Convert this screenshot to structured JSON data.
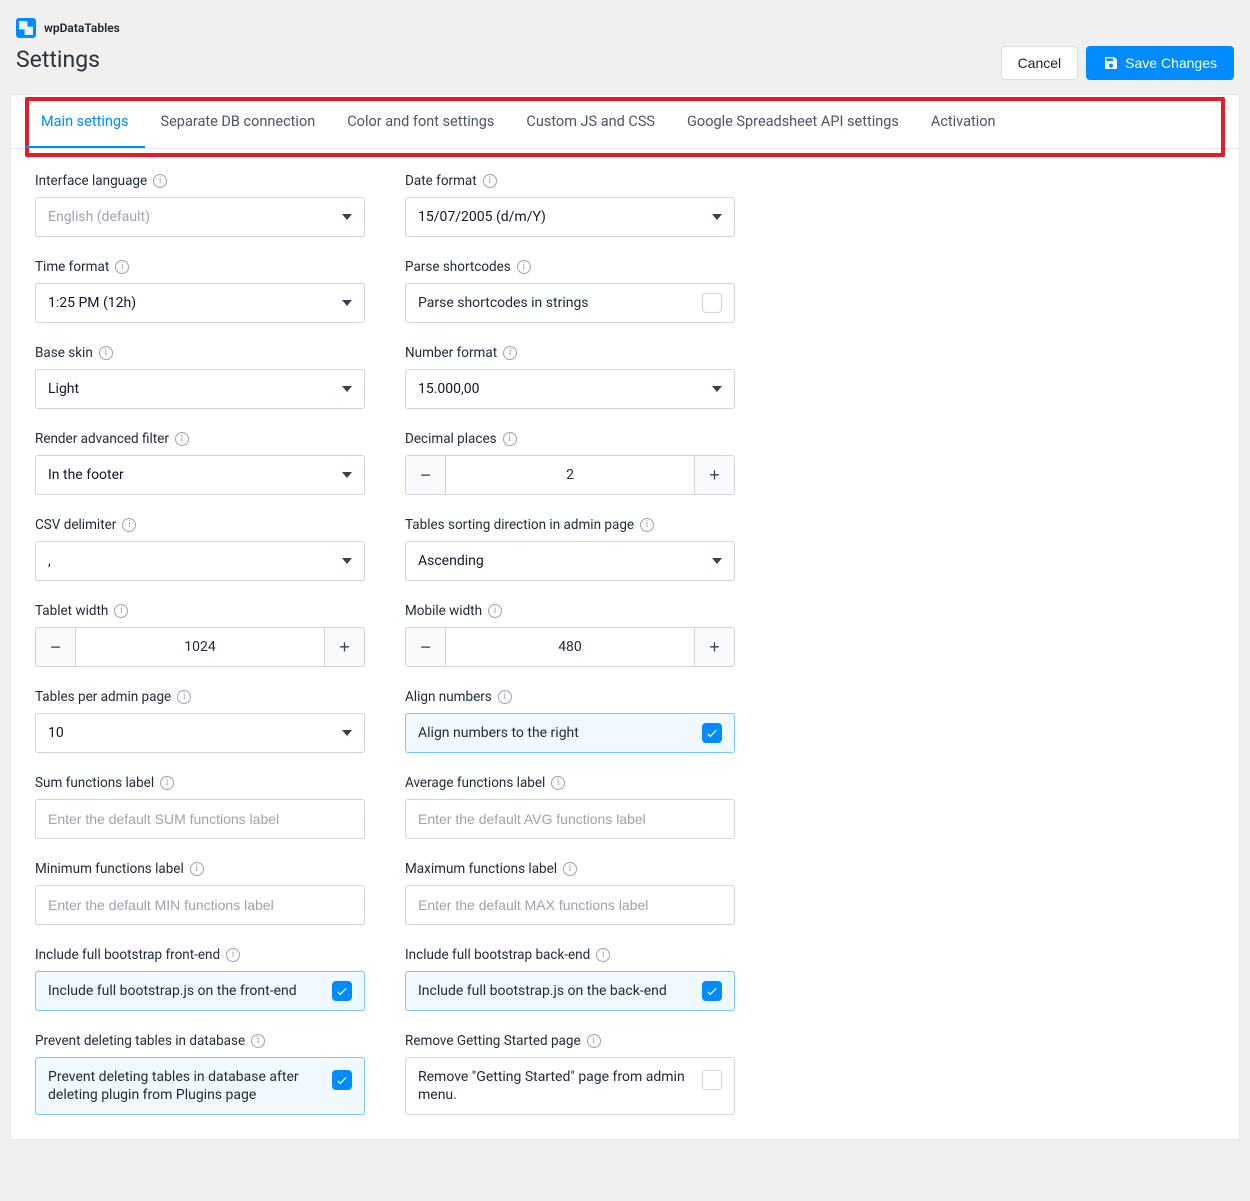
{
  "brand": {
    "name": "wpDataTables"
  },
  "page": {
    "title": "Settings"
  },
  "actions": {
    "cancel_label": "Cancel",
    "save_label": "Save Changes"
  },
  "tabs": [
    {
      "label": "Main settings",
      "active": true
    },
    {
      "label": "Separate DB connection"
    },
    {
      "label": "Color and font settings"
    },
    {
      "label": "Custom JS and CSS"
    },
    {
      "label": "Google Spreadsheet API settings"
    },
    {
      "label": "Activation"
    }
  ],
  "fields": {
    "interface_language": {
      "label": "Interface language",
      "value": "English (default)",
      "placeholder_like": true
    },
    "date_format": {
      "label": "Date format",
      "value": "15/07/2005 (d/m/Y)"
    },
    "time_format": {
      "label": "Time format",
      "value": "1:25 PM (12h)"
    },
    "parse_shortcodes": {
      "label": "Parse shortcodes",
      "text": "Parse shortcodes in strings",
      "checked": false
    },
    "base_skin": {
      "label": "Base skin",
      "value": "Light"
    },
    "number_format": {
      "label": "Number format",
      "value": "15.000,00"
    },
    "render_filter": {
      "label": "Render advanced filter",
      "value": "In the footer"
    },
    "decimal_places": {
      "label": "Decimal places",
      "value": "2"
    },
    "csv_delimiter": {
      "label": "CSV delimiter",
      "value": ","
    },
    "sort_direction": {
      "label": "Tables sorting direction in admin page",
      "value": "Ascending"
    },
    "tablet_width": {
      "label": "Tablet width",
      "value": "1024"
    },
    "mobile_width": {
      "label": "Mobile width",
      "value": "480"
    },
    "tables_per_page": {
      "label": "Tables per admin page",
      "value": "10"
    },
    "align_numbers": {
      "label": "Align numbers",
      "text": "Align numbers to the right",
      "checked": true
    },
    "sum_label": {
      "label": "Sum functions label",
      "placeholder": "Enter the default SUM functions label"
    },
    "avg_label": {
      "label": "Average functions label",
      "placeholder": "Enter the default AVG functions label"
    },
    "min_label": {
      "label": "Minimum functions label",
      "placeholder": "Enter the default MIN functions label"
    },
    "max_label": {
      "label": "Maximum functions label",
      "placeholder": "Enter the default MAX functions label"
    },
    "bootstrap_front": {
      "label": "Include full bootstrap front-end",
      "text": "Include full bootstrap.js on the front-end",
      "checked": true
    },
    "bootstrap_back": {
      "label": "Include full bootstrap back-end",
      "text": "Include full bootstrap.js on the back-end",
      "checked": true
    },
    "prevent_delete": {
      "label": "Prevent deleting tables in database",
      "text": "Prevent deleting tables in database after deleting plugin from Plugins page",
      "checked": true,
      "multiline": true
    },
    "remove_gs": {
      "label": "Remove Getting Started page",
      "text": "Remove \"Getting Started\" page from admin menu.",
      "checked": false,
      "multiline": true
    }
  }
}
